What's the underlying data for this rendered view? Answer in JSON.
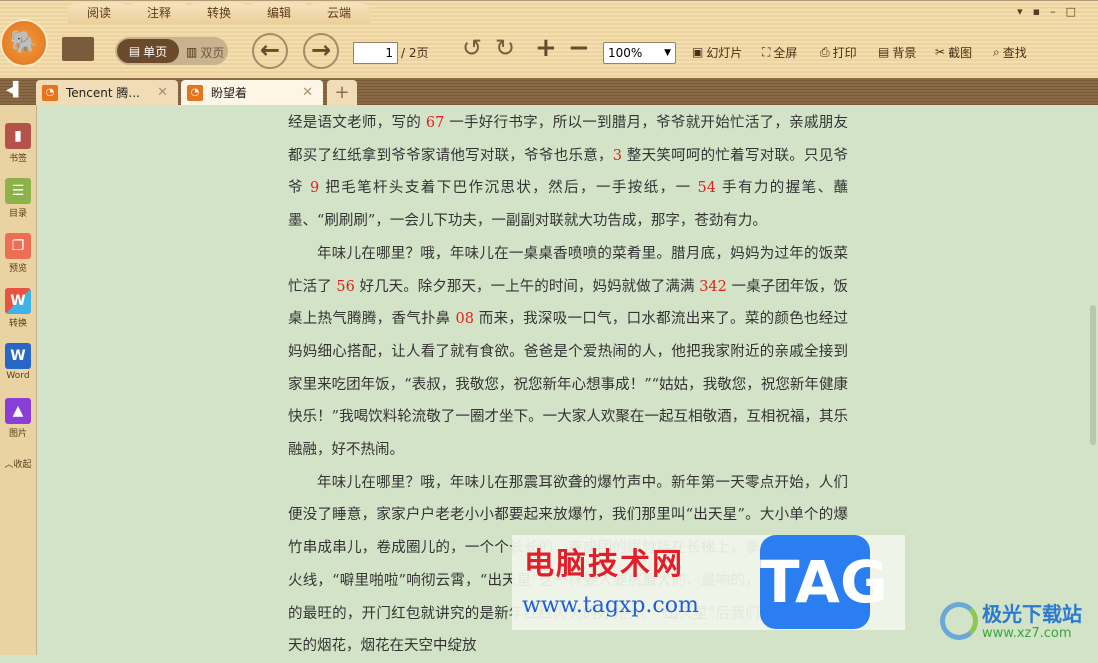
{
  "menu_tabs": [
    "阅读",
    "注释",
    "转换",
    "编辑",
    "云端"
  ],
  "toolbar": {
    "single_page": "单页",
    "double_page": "双页",
    "page_current": "1",
    "page_total": "/ 2页",
    "zoom": "100%",
    "slideshow": "幻灯片",
    "fullscreen": "全屏",
    "print": "打印",
    "background": "背景",
    "screenshot": "截图",
    "find": "查找"
  },
  "doc_tabs": [
    {
      "title": "Tencent 腾..."
    },
    {
      "title": "盼望着"
    }
  ],
  "sidebar": [
    {
      "label": "书签",
      "color": "#b5524a"
    },
    {
      "label": "目录",
      "color": "#8db24a"
    },
    {
      "label": "预览",
      "color": "#ee6e55"
    },
    {
      "label": "转换",
      "color": "#e8533f"
    },
    {
      "label": "Word",
      "color": "#2866c8"
    },
    {
      "label": "图片",
      "color": "#8a3ed6"
    }
  ],
  "collapse": "︿收起",
  "content": {
    "p1": [
      "经是语文老师，写的 ",
      "67",
      " 一手好行书字，所以一到腊月，爷爷就开始忙活了，亲戚朋友都买了红纸拿到爷爷家请他写对联，爷爷也乐意，",
      "3",
      " 整天笑呵呵的忙着写对联。只见爷爷 ",
      "9",
      " 把毛笔杆头支着下巴作沉思状，然后，一手按纸，一 ",
      "54",
      " 手有力的握笔、蘸墨、“刷刷刷”，一会儿下功夫，一副副对联就大功告成，那字，苍劲有力。"
    ],
    "p2": [
      "年味儿在哪里？哦，年味儿在一桌桌香喷喷的菜肴里。腊月底，妈妈为过年的饭菜忙活了 ",
      "56",
      " 好几天。除夕那天，一上午的时间，妈妈就做了满满 ",
      "342",
      " 一桌子团年饭，饭桌上热气腾腾，香气扑鼻 ",
      "08",
      " 而来，我深吸一口气，口水都流出来了。菜的颜色也经过妈妈细心搭配，让人看了就有食欲。爸爸是个爱热闹的人，他把我家附近的亲戚全接到家里来吃团年饭，“表叔，我敬您，祝您新年心想事成！”“姑姑，我敬您，祝您新年健康快乐！”我喝饮料轮流敬了一圈才坐下。一大家人欢聚在一起互相敬酒，互相祝福，其乐融融，好不热闹。"
    ],
    "p3": "年味儿在哪里？哦，年味儿在那震耳欲聋的爆竹声中。新年第一天零点开始，人们便没了睡意，家家户户老老小小都要起来放爆竹，我们那里叫“出天星”。大小单个的爆竹串成串儿，卷成圈儿的，一个个长长的，卷成团的爆竹挂在长梯上，拿起火把点燃导火线，“噼里啪啦”响彻云霄，“出天星”这一样要人要挑最大的、最响的，点火把也要烧的最旺的，开门红包就讲究的是新年红红火火的好兆头。“出天星”后我们还放了直窜云天的烟花，烟花在天空中绽放"
  },
  "watermark": {
    "cn": "电脑技术网",
    "url": "www.tagxp.com",
    "tag": "TAG"
  },
  "brand": {
    "name": "极光下载站",
    "url": "www.xz7.com"
  }
}
